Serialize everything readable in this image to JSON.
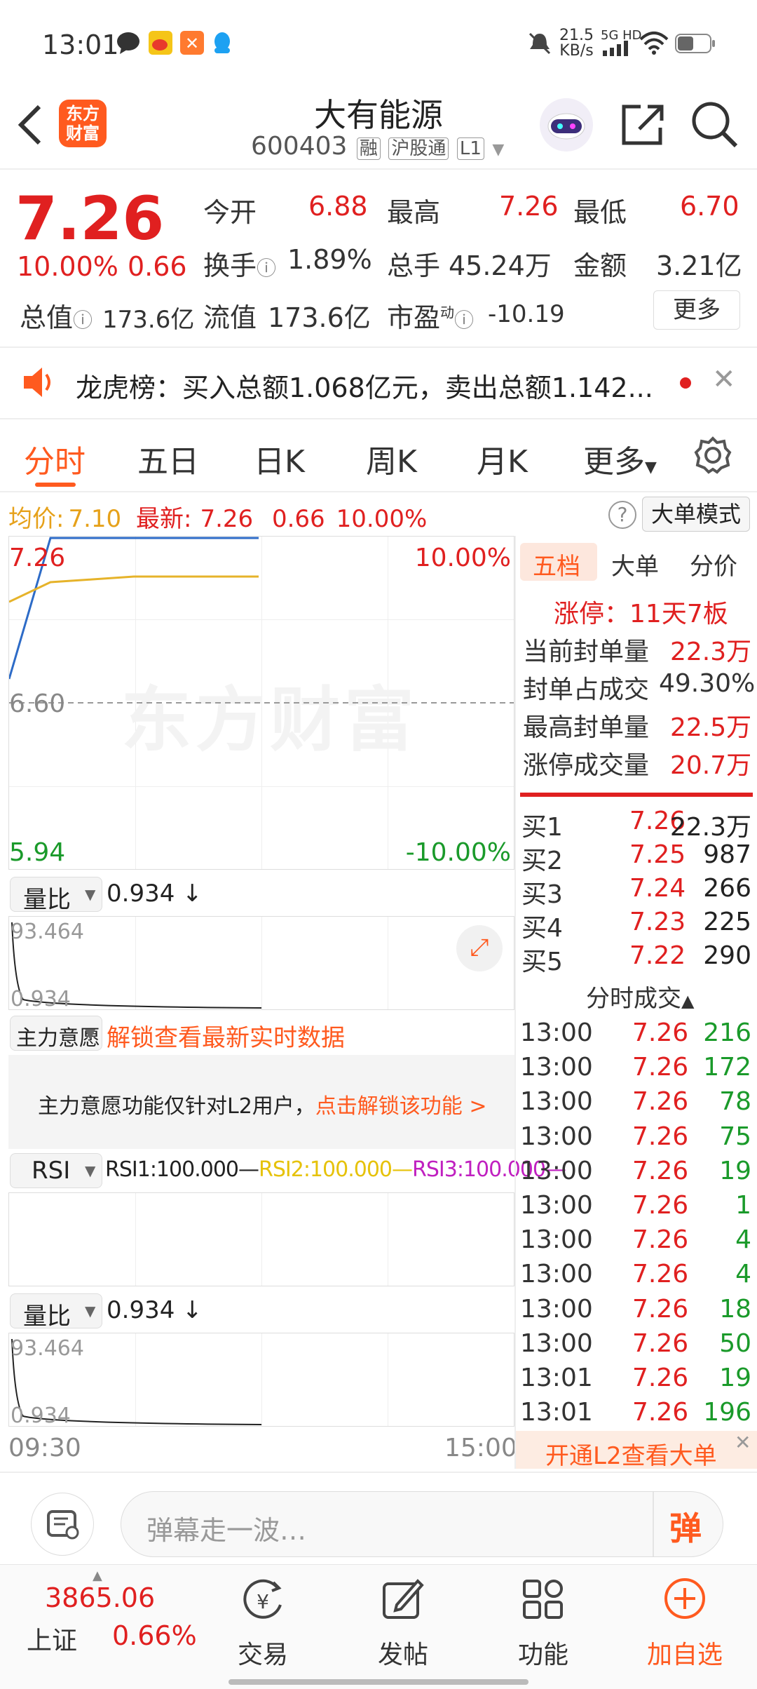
{
  "status": {
    "time": "13:01",
    "net_speed": "21.5",
    "net_unit": "KB/s",
    "net_type": "5G HD"
  },
  "header": {
    "title": "大有能源",
    "code": "600403",
    "tags": [
      "融",
      "沪股通",
      "L1"
    ],
    "logo_line1": "东方",
    "logo_line2": "财富"
  },
  "quote": {
    "price": "7.26",
    "change_pct": "10.00%",
    "change": "0.66",
    "open_label": "今开",
    "open": "6.88",
    "high_label": "最高",
    "high": "7.26",
    "low_label": "最低",
    "low": "6.70",
    "turnover_label": "换手",
    "turnover": "1.89%",
    "volume_label": "总手",
    "volume": "45.24万",
    "amount_label": "金额",
    "amount": "3.21亿",
    "mktcap_label": "总值",
    "mktcap": "173.6亿",
    "float_label": "流值",
    "float": "173.6亿",
    "pe_label": "市盈",
    "pe_sup": "动",
    "pe": "-10.19",
    "more_label": "更多"
  },
  "notice": {
    "text": "龙虎榜：买入总额1.068亿元，卖出总额1.142..."
  },
  "tabs": {
    "t1": "分时",
    "t2": "五日",
    "t3": "日K",
    "t4": "周K",
    "t5": "月K",
    "t6": "更多"
  },
  "chart_info": {
    "avg_label": "均价:",
    "avg": "7.10",
    "latest_label": "最新:",
    "latest": "7.26",
    "chg": "0.66",
    "pct": "10.00%",
    "mode_label": "大单模式"
  },
  "chart_data": {
    "type": "line",
    "y_labels": {
      "top": "7.26",
      "mid": "6.60",
      "bottom": "5.94",
      "top_pct": "10.00%",
      "bottom_pct": "-10.00%"
    },
    "x_labels": {
      "start": "09:30",
      "end": "15:00"
    },
    "ylim": [
      5.94,
      7.26
    ],
    "series": [
      {
        "values": [
          6.7,
          7.26,
          7.26,
          7.26,
          7.26,
          7.26,
          7.26
        ],
        "color": "#2d6bc7"
      },
      {
        "values": [
          7.0,
          7.08,
          7.09,
          7.1,
          7.1,
          7.1,
          7.1
        ],
        "color": "#e6b32a"
      }
    ]
  },
  "indicators": {
    "vr_label": "量比",
    "vr_val": "0.934",
    "vr_top": "93.464",
    "vr_bottom": "0.934",
    "zl_label": "主力意愿",
    "zl_unlock": "解锁查看最新实时数据",
    "zl_msg1": "主力意愿功能仅针对L2用户，",
    "zl_msg2": "点击解锁该功能 >",
    "rsi_label": "RSI",
    "rsi1": "RSI1:100.000—",
    "rsi2": "RSI2:100.000—",
    "rsi3": "RSI3:100.000—",
    "vr2_label": "量比",
    "vr2_val": "0.934",
    "vr2_top": "93.464",
    "vr2_bottom": "0.934"
  },
  "panel": {
    "tab1": "五档",
    "tab2": "大单",
    "tab3": "分价",
    "limit_label": "涨停：",
    "limit_val": "11天7板",
    "s1_label": "当前封单量",
    "s1_val": "22.3万",
    "s2_label": "封单占成交",
    "s2_val": "49.30%",
    "s3_label": "最高封单量",
    "s3_val": "22.5万",
    "s4_label": "涨停成交量",
    "s4_val": "20.7万",
    "bids": [
      {
        "label": "买1",
        "price": "7.26",
        "vol": "22.3万"
      },
      {
        "label": "买2",
        "price": "7.25",
        "vol": "987"
      },
      {
        "label": "买3",
        "price": "7.24",
        "vol": "266"
      },
      {
        "label": "买4",
        "price": "7.23",
        "vol": "225"
      },
      {
        "label": "买5",
        "price": "7.22",
        "vol": "290"
      }
    ],
    "trades_title": "分时成交",
    "trades": [
      {
        "t": "13:00",
        "p": "7.26",
        "v": "216"
      },
      {
        "t": "13:00",
        "p": "7.26",
        "v": "172"
      },
      {
        "t": "13:00",
        "p": "7.26",
        "v": "78"
      },
      {
        "t": "13:00",
        "p": "7.26",
        "v": "75"
      },
      {
        "t": "13:00",
        "p": "7.26",
        "v": "19"
      },
      {
        "t": "13:00",
        "p": "7.26",
        "v": "1"
      },
      {
        "t": "13:00",
        "p": "7.26",
        "v": "4"
      },
      {
        "t": "13:00",
        "p": "7.26",
        "v": "4"
      },
      {
        "t": "13:00",
        "p": "7.26",
        "v": "18"
      },
      {
        "t": "13:00",
        "p": "7.26",
        "v": "50"
      },
      {
        "t": "13:01",
        "p": "7.26",
        "v": "19"
      },
      {
        "t": "13:01",
        "p": "7.26",
        "v": "196"
      }
    ],
    "l2_banner": "开通L2查看大单"
  },
  "comment": {
    "placeholder": "弹幕走一波…",
    "danmu_label": "弹"
  },
  "nav": {
    "index_val": "3865.06",
    "index_name": "上证",
    "index_pct": "0.66%",
    "trade": "交易",
    "post": "发帖",
    "func": "功能",
    "add": "加自选"
  }
}
